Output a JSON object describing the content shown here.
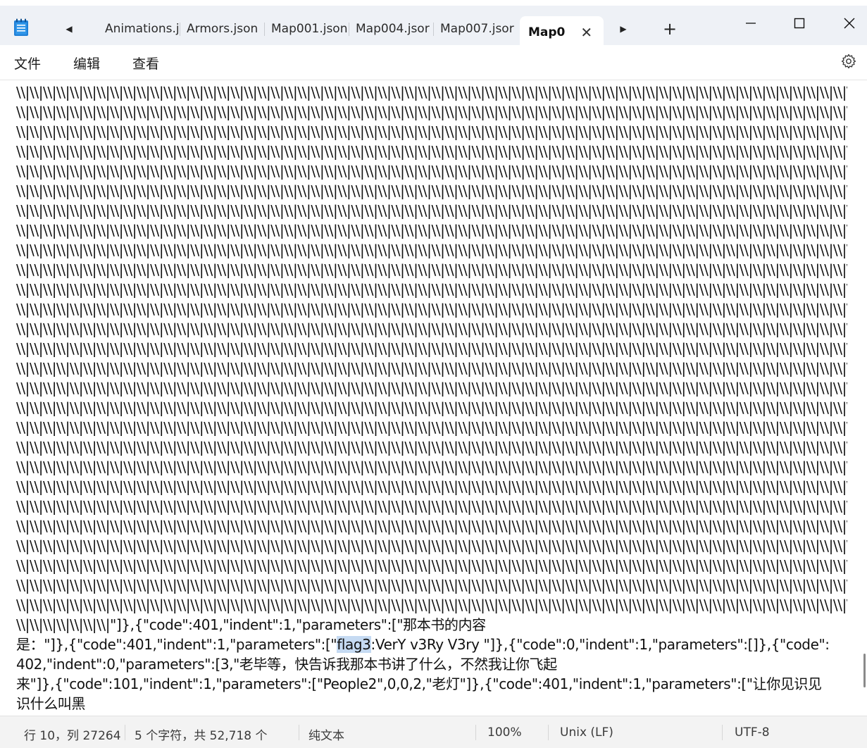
{
  "window": {
    "tabs": [
      {
        "label": "Animations.j"
      },
      {
        "label": "Armors.json"
      },
      {
        "label": "Map001.json"
      },
      {
        "label": "Map004.jsor"
      },
      {
        "label": "Map007.jsor"
      }
    ],
    "active_tab": {
      "label": "Map0",
      "close_glyph": "✕"
    },
    "nav_left_glyph": "◀",
    "nav_right_glyph": "▶",
    "add_tab_glyph": "+",
    "minimize_glyph": "—",
    "close_glyph": "✕"
  },
  "menu": {
    "file": "文件",
    "edit": "编辑",
    "view": "查看"
  },
  "editor": {
    "repeat_line": "\\\\|\\\\|\\\\|\\\\|\\\\|\\\\|\\\\|\\\\|\\\\|\\\\|\\\\|\\\\|\\\\|\\\\|\\\\|\\\\|\\\\|\\\\|\\\\|\\\\|\\\\|\\\\|\\\\|\\\\|\\\\|\\\\|\\\\|\\\\|\\\\|\\\\|\\\\|\\\\|\\\\|\\\\|\\\\|\\\\|\\\\|\\\\|\\\\|\\\\|\\\\|\\\\|\\\\|\\\\|\\\\|\\\\|\\\\|\\\\|\\\\|\\\\|\\\\|\\\\|\\\\|\\\\|\\\\|\\\\|\\\\|\\\\|\\\\|\\\\|\\\\|\\\\|\\\\|\\\\|\\\\|\\\\|\\\\|\\\\|\\\\|\\\\|\\\\|\\\\|\\\\|\\\\|\\\\|\\\\|\\\\|\\\\|\\\\|\\\\|",
    "line_tail": "\\\\|\\\\|\\\\|\\\\|\\\\|\\\\|\\\\|\"]},{\"code\":401,\"indent\":1,\"parameters\":[\"那本书的内容",
    "line_b_before": "是：\"]},{\"code\":401,\"indent\":1,\"parameters\":[\"",
    "line_b_selected": "flag3",
    "line_b_after": ":VerY v3Ry V3ry \"]},{\"code\":0,\"indent\":1,\"parameters\":[]},{\"code\":",
    "line_c": "402,\"indent\":0,\"parameters\":[3,\"老毕等，快告诉我那本书讲了什么，不然我让你飞起",
    "line_d": "来\"]},{\"code\":101,\"indent\":1,\"parameters\":[\"People2\",0,0,2,\"老灯\"]},{\"code\":401,\"indent\":1,\"parameters\":[\"让你见识见",
    "line_e": "识什么叫黑"
  },
  "status": {
    "position": "行 10，列 27264",
    "selection": "5 个字符，共 52,718 个",
    "format": "纯文本",
    "zoom": "100%",
    "line_ending": "Unix (LF)",
    "encoding": "UTF-8"
  }
}
